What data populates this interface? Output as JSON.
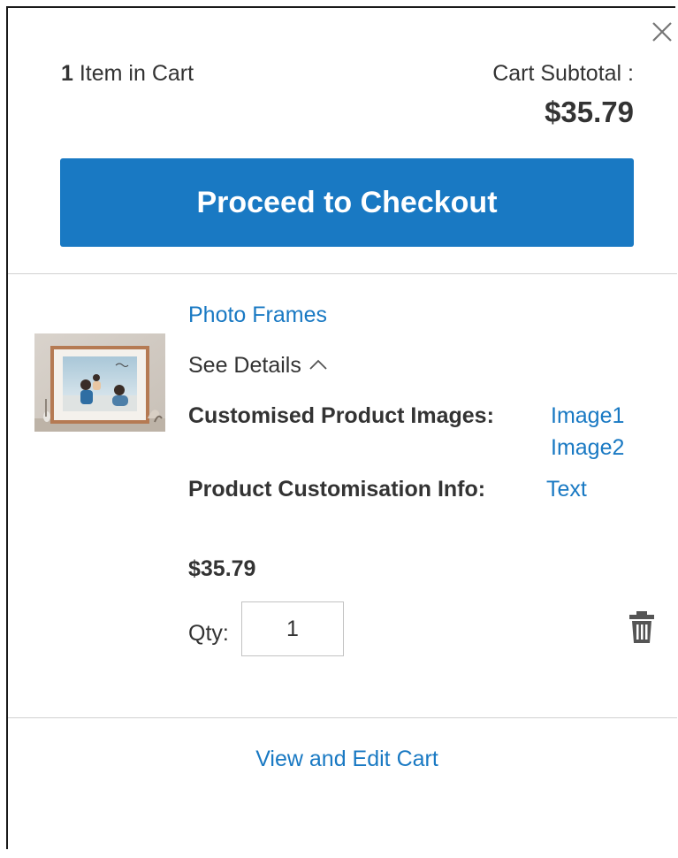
{
  "summary": {
    "count": "1",
    "count_label": " Item in Cart",
    "subtotal_label": "Cart Subtotal :",
    "subtotal_price": "$35.79"
  },
  "checkout": {
    "label": "Proceed to Checkout"
  },
  "item": {
    "name": "Photo Frames",
    "see_details": "See Details",
    "options": {
      "images_label": "Customised Product Images:",
      "images": [
        "Image1",
        "Image2"
      ],
      "info_label": "Product Customisation Info:",
      "info_value": "Text"
    },
    "price": "$35.79",
    "qty_label": "Qty:",
    "qty_value": "1"
  },
  "footer": {
    "view_edit_label": "View and Edit Cart"
  },
  "icons": {
    "close": "close-icon",
    "chevron": "chevron-up-icon",
    "delete": "trash-icon"
  },
  "colors": {
    "accent": "#1979c3",
    "text": "#333333",
    "divider": "#d1d1d1",
    "icon": "#757575"
  }
}
